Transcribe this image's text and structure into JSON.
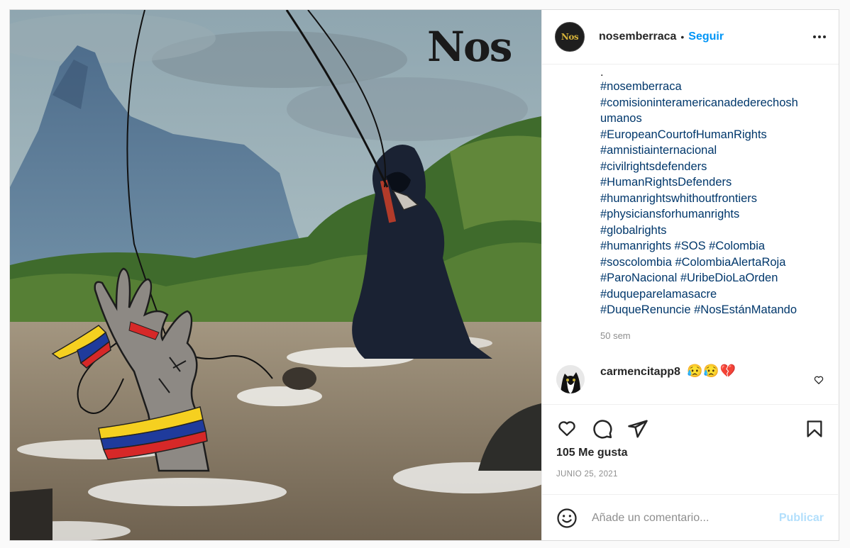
{
  "post": {
    "image_alt": "Illustration: grim reaper figure fishing a hand wrapped in a Colombian flag out of a muddy river, mountain in background",
    "watermark_text": "Nos",
    "colors": {
      "flag_yellow": "#f5d020",
      "flag_blue": "#1f3b9c",
      "flag_red": "#d62828",
      "link": "#00376b",
      "follow": "#0095f6"
    }
  },
  "header": {
    "username": "nosemberraca",
    "separator": "•",
    "follow_label": "Seguir",
    "more_icon": "more-horizontal-icon"
  },
  "caption": {
    "period": ".",
    "hashtag_lines": [
      "#nosemberraca",
      "#comisioninteramericanadederechosh",
      "umanos",
      "#EuropeanCourtofHumanRights",
      "#amnistiainternacional",
      "#civilrightsdefenders",
      "#HumanRightsDefenders",
      "#humanrightswhithoutfrontiers",
      "#physiciansforhumanrights",
      "#globalrights",
      "#humanrights #SOS #Colombia",
      "#soscolombia #ColombiaAlertaRoja",
      "#ParoNacional #UribeDioLaOrden",
      "#duqueparelamasacre",
      "#DuqueRenuncie #NosEstánMatando"
    ],
    "time": "50 sem"
  },
  "comment": {
    "username": "carmencitapp8",
    "text": "😥😥💔",
    "like_icon": "heart-outline-small-icon"
  },
  "actions": {
    "like_icon": "heart-icon",
    "comment_icon": "comment-icon",
    "share_icon": "paper-plane-icon",
    "save_icon": "bookmark-icon"
  },
  "likes_label": "105 Me gusta",
  "date_label": "JUNIO 25, 2021",
  "add_comment": {
    "emoji_icon": "smiley-icon",
    "placeholder": "Añade un comentario...",
    "publish_label": "Publicar"
  }
}
